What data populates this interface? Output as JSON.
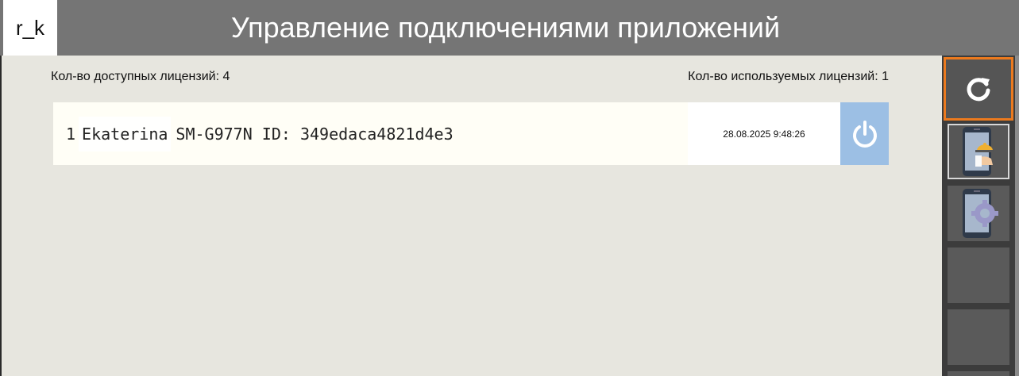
{
  "header": {
    "logo": "r_k",
    "title": "Управление подключениями приложений"
  },
  "licenses": {
    "available": "Кол-во доступных лицензий: 4",
    "used": "Кол-во используемых лицензий: 1"
  },
  "connections": [
    {
      "index": "1",
      "name": "Ekaterina",
      "device": "SM-G977N ID: 349edaca4821d4e3",
      "timestamp": "28.08.2025 9:48:26"
    }
  ],
  "sidebar": {
    "buttons": [
      {
        "icon": "refresh-icon"
      },
      {
        "icon": "phone-waiter-icon"
      },
      {
        "icon": "phone-settings-icon"
      },
      {
        "icon": ""
      },
      {
        "icon": ""
      }
    ]
  },
  "colors": {
    "accent": "#ec7a1e",
    "power_button": "#9cbfe4",
    "header": "#757575",
    "background": "#e7e6df"
  }
}
